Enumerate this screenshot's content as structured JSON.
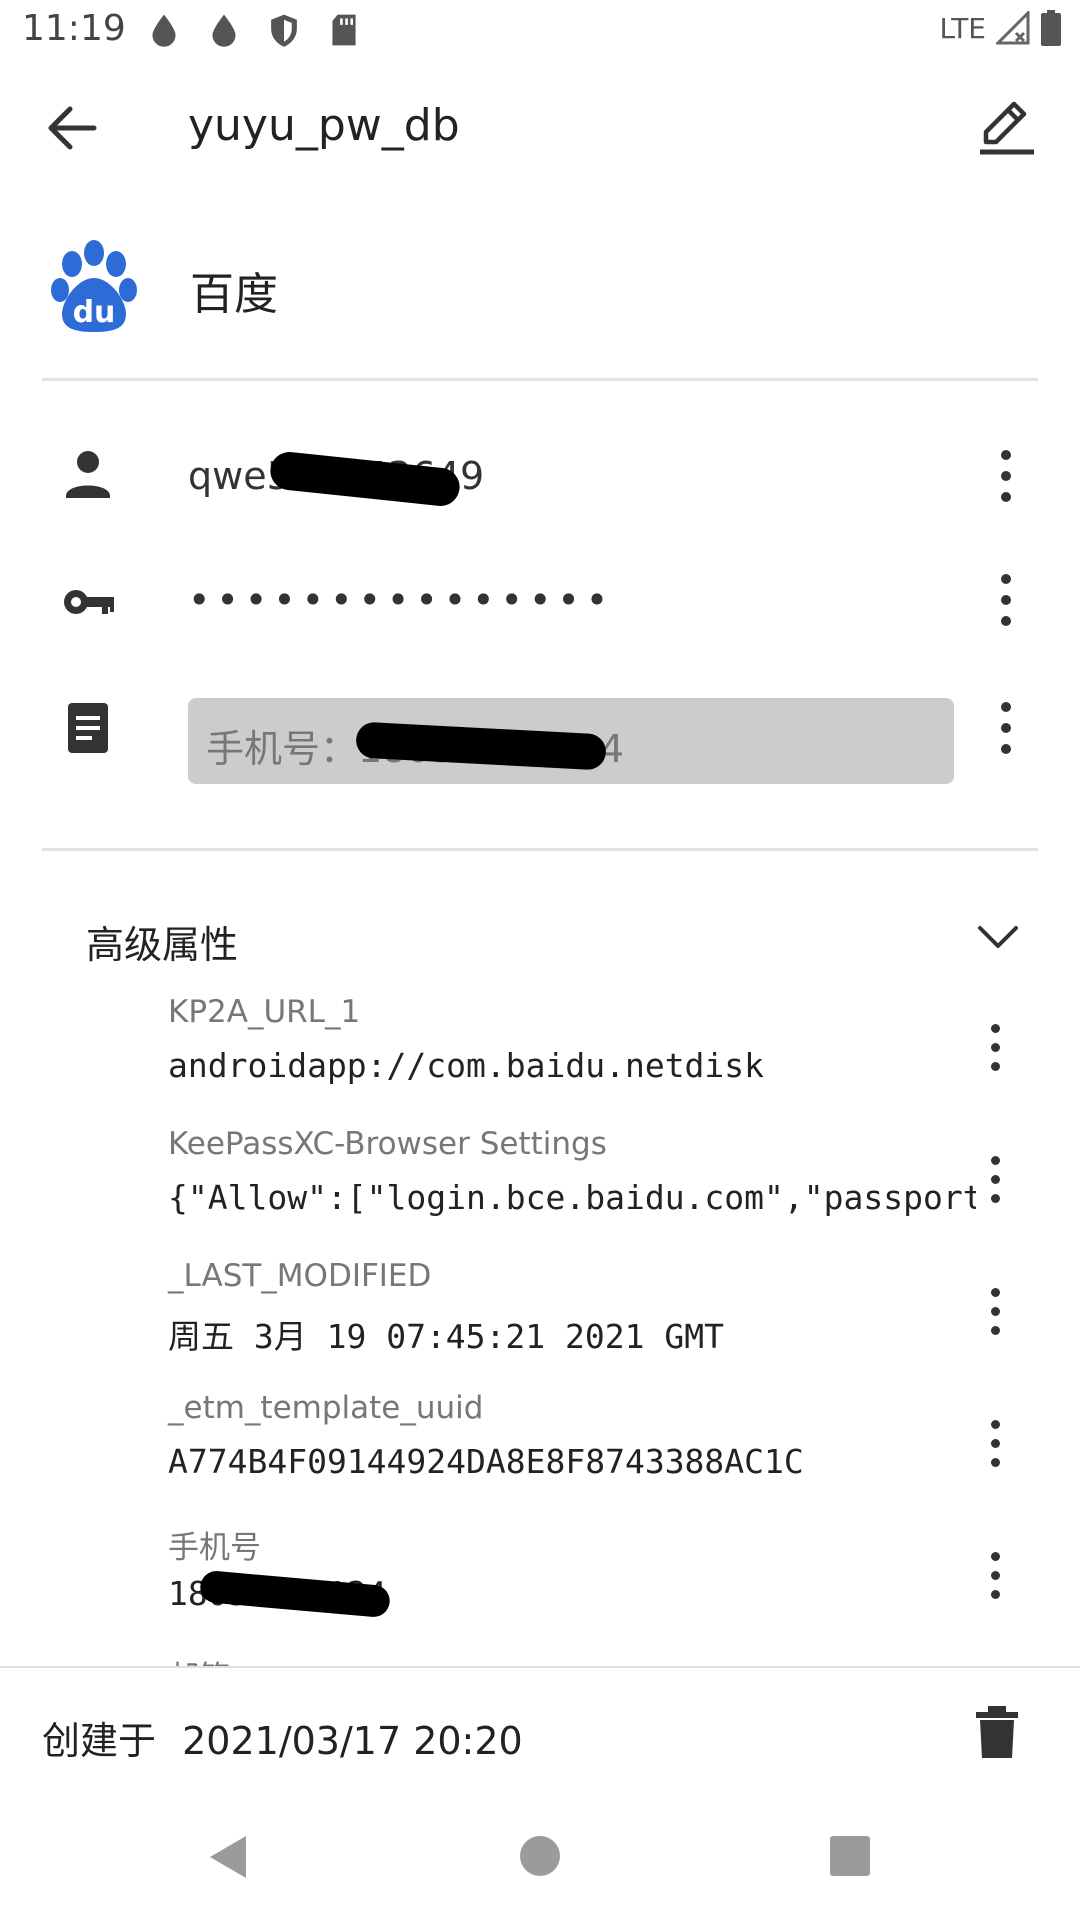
{
  "status_bar": {
    "time": "11:19",
    "network": "LTE"
  },
  "app_bar": {
    "title": "yuyu_pw_db"
  },
  "entry": {
    "title": "百度",
    "username": "qwe511453649",
    "password_mask": "•••••••••••••••",
    "notes": "手机号：18030452124"
  },
  "advanced": {
    "title": "高级属性",
    "attributes": [
      {
        "key": "KP2A_URL_1",
        "value": "androidapp://com.baidu.netdisk"
      },
      {
        "key": "KeePassXC-Browser Settings",
        "value": "{\"Allow\":[\"login.bce.baidu.com\",\"passport.baidu.com\"]}"
      },
      {
        "key": "_LAST_MODIFIED",
        "value": "周五 3月 19 07:45:21 2021 GMT"
      },
      {
        "key": "_etm_template_uuid",
        "value": "A774B4F09144924DA8E8F8743388AC1C"
      },
      {
        "key": "手机号",
        "value": "18030452124"
      }
    ],
    "partial_key": "邮箱"
  },
  "footer": {
    "created_label": "创建于",
    "created_value": "2021/03/17 20:20"
  },
  "colors": {
    "accent": "#2D6CD6",
    "text_primary": "#222222",
    "text_secondary": "#777777",
    "notes_bg": "#CCCCCC"
  }
}
